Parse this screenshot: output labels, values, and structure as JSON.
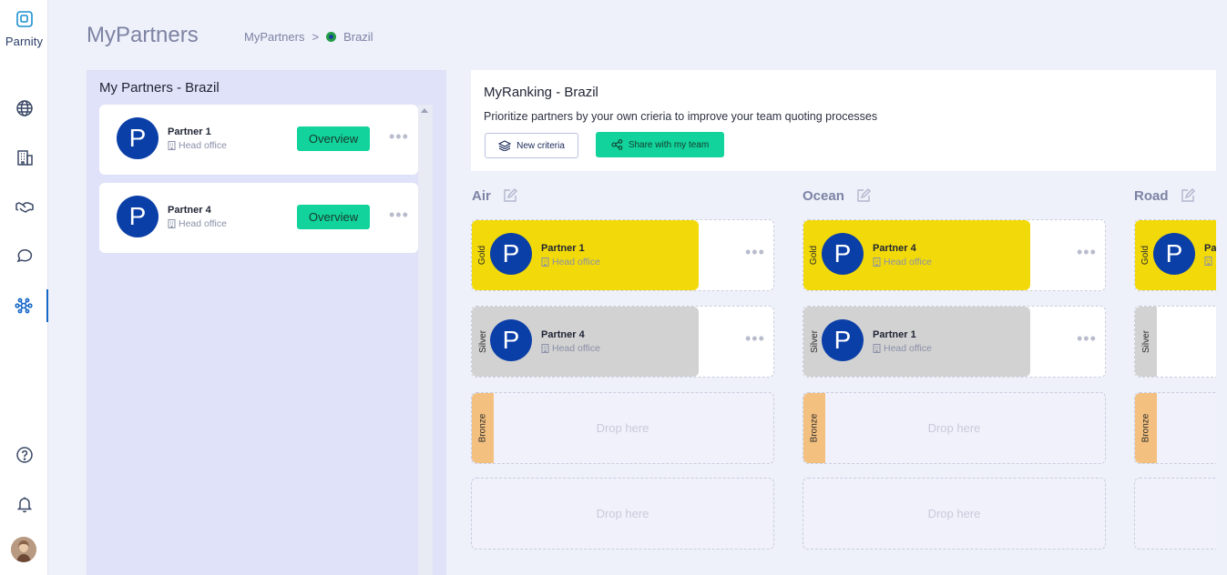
{
  "app": {
    "logo_text": "Parnity"
  },
  "header": {
    "title": "MyPartners",
    "breadcrumb": [
      "MyPartners",
      ">",
      "Brazil"
    ]
  },
  "sidebar": {
    "items": [
      {
        "icon": "globe-icon"
      },
      {
        "icon": "building-icon"
      },
      {
        "icon": "handshake-icon"
      },
      {
        "icon": "chat-icon"
      },
      {
        "icon": "network-icon",
        "active": true
      },
      {
        "icon": "help-icon"
      },
      {
        "icon": "bell-icon"
      }
    ],
    "accent": "#1466c8"
  },
  "left_panel": {
    "title": "My Partners - Brazil",
    "partners": [
      {
        "avatar": "P",
        "name": "Partner 1",
        "sub": "Head office",
        "action": "Overview"
      },
      {
        "avatar": "P",
        "name": "Partner 4",
        "sub": "Head office",
        "action": "Overview"
      }
    ]
  },
  "ranking": {
    "title": "MyRanking - Brazil",
    "description": "Prioritize partners by your own crieria to improve your team quoting processes",
    "new_criteria_label": "New criteria",
    "share_label": "Share with my team"
  },
  "columns": [
    {
      "name": "Air",
      "slots": [
        {
          "tier": "Gold",
          "partner": {
            "avatar": "P",
            "name": "Partner 1",
            "sub": "Head office"
          }
        },
        {
          "tier": "Silver",
          "partner": {
            "avatar": "P",
            "name": "Partner 4",
            "sub": "Head office"
          }
        },
        {
          "tier": "Bronze",
          "drop": "Drop here"
        },
        {
          "tier": "",
          "drop": "Drop here"
        }
      ]
    },
    {
      "name": "Ocean",
      "slots": [
        {
          "tier": "Gold",
          "partner": {
            "avatar": "P",
            "name": "Partner 4",
            "sub": "Head office"
          }
        },
        {
          "tier": "Silver",
          "partner": {
            "avatar": "P",
            "name": "Partner 1",
            "sub": "Head office"
          }
        },
        {
          "tier": "Bronze",
          "drop": "Drop here"
        },
        {
          "tier": "",
          "drop": "Drop here"
        }
      ]
    },
    {
      "name": "Road",
      "slots": [
        {
          "tier": "Gold",
          "partner": {
            "avatar": "P",
            "name": "Pa",
            "sub": ""
          }
        },
        {
          "tier": "Silver"
        },
        {
          "tier": "Bronze"
        },
        {
          "tier": ""
        }
      ]
    }
  ],
  "colors": {
    "gold": "#f2da0a",
    "silver": "#d2d2d2",
    "bronze": "#f4c07f",
    "primary_button": "#12d39b",
    "avatar": "#0b3fa8"
  }
}
